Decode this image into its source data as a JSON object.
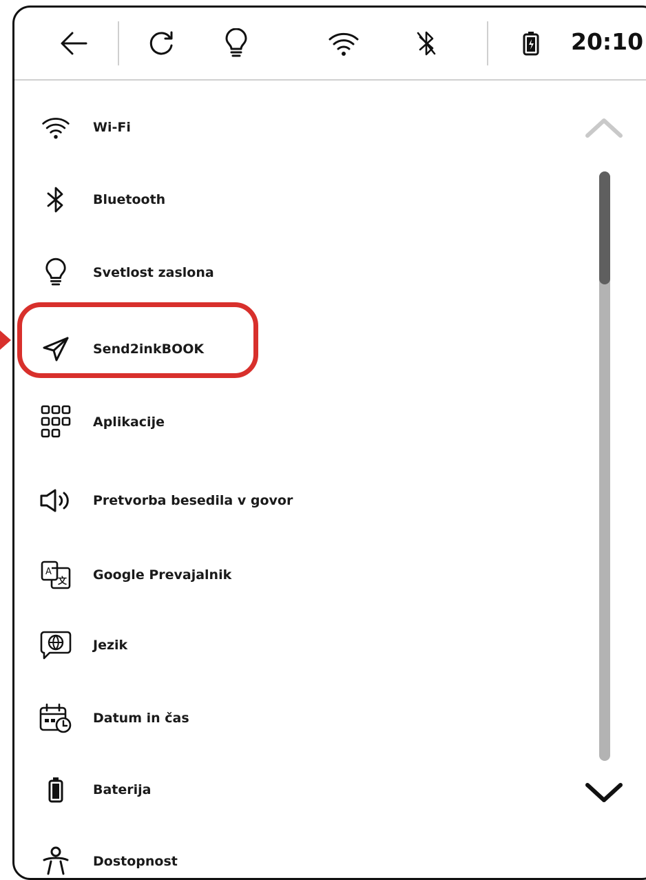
{
  "status_bar": {
    "icons": [
      "back-arrow-icon",
      "refresh-icon",
      "lightbulb-icon",
      "wifi-icon",
      "bluetooth-off-icon",
      "battery-icon"
    ],
    "time": "20:10"
  },
  "menu": {
    "items": [
      {
        "label": "Wi-Fi",
        "icon": "wifi-icon"
      },
      {
        "label": "Bluetooth",
        "icon": "bluetooth-icon"
      },
      {
        "label": "Svetlost zaslona",
        "icon": "lightbulb-icon"
      },
      {
        "label": "Send2inkBOOK",
        "icon": "send-icon",
        "highlighted": true
      },
      {
        "label": "Aplikacije",
        "icon": "apps-grid-icon"
      },
      {
        "label": "Pretvorba besedila v govor",
        "icon": "speaker-icon"
      },
      {
        "label": "Google Prevajalnik",
        "icon": "translate-icon"
      },
      {
        "label": "Jezik",
        "icon": "globe-chat-icon"
      },
      {
        "label": "Datum in čas",
        "icon": "calendar-clock-icon"
      },
      {
        "label": "Baterija",
        "icon": "battery-icon"
      },
      {
        "label": "Dostopnost",
        "icon": "accessibility-icon"
      }
    ]
  },
  "scrollbar": {
    "up_icon": "chevron-up-icon",
    "down_icon": "chevron-down-icon",
    "position": 0
  },
  "highlight_color": "#d8302c"
}
